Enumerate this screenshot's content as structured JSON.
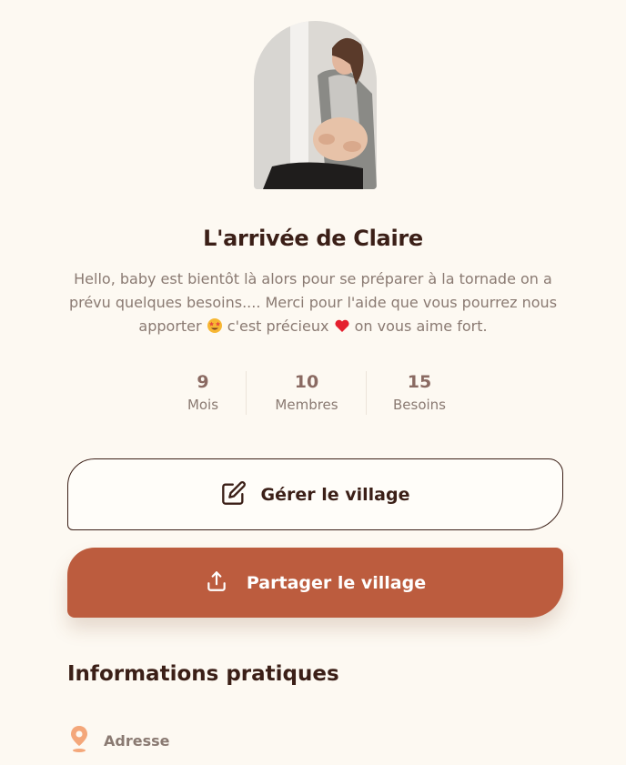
{
  "village": {
    "title": "L'arrivée de Claire",
    "description_part1": "Hello, baby est bientôt là alors pour se préparer à la tornade on a prévu quelques besoins.... Merci pour l'aide que vous pourrez nous apporter ",
    "description_part2": " c'est précieux ",
    "description_part3": " on vous aime fort."
  },
  "stats": [
    {
      "value": "9",
      "label": "Mois"
    },
    {
      "value": "10",
      "label": "Membres"
    },
    {
      "value": "15",
      "label": "Besoins"
    }
  ],
  "actions": {
    "manage_label": "Gérer le village",
    "share_label": "Partager le village"
  },
  "info": {
    "section_title": "Informations pratiques",
    "address_label": "Adresse"
  },
  "icons": {
    "manage": "edit-icon",
    "share": "share-upload-icon",
    "address": "location-pin-icon"
  },
  "colors": {
    "background": "#fdf9f2",
    "primary": "#bc5c3e",
    "text_dark": "#3b1f17",
    "text_muted": "#8a7a72",
    "pin": "#f4a77a"
  }
}
